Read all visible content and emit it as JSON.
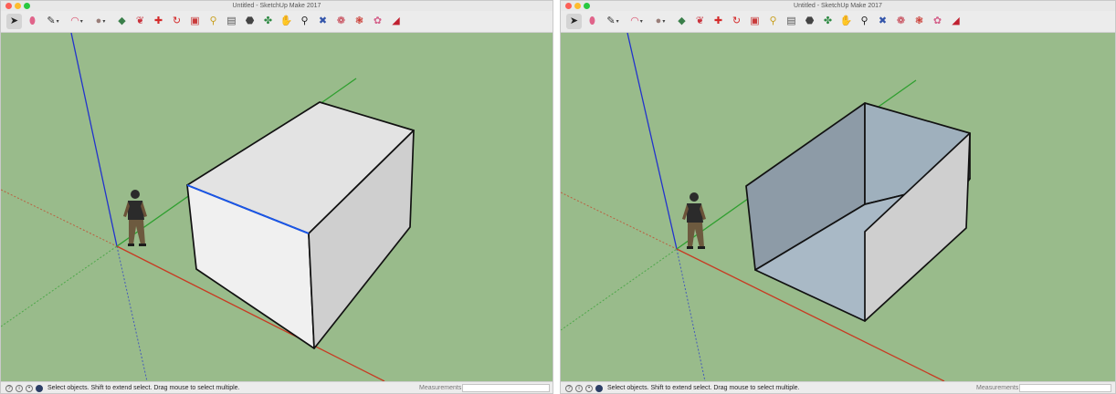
{
  "windows": [
    {
      "title": "Untitled - SketchUp Make 2017",
      "status_text": "Select objects. Shift to extend select. Drag mouse to select multiple.",
      "measurements_label": "Measurements",
      "measurements_value": ""
    },
    {
      "title": "Untitled - SketchUp Make 2017",
      "status_text": "Select objects. Shift to extend select. Drag mouse to select multiple.",
      "measurements_label": "Measurements",
      "measurements_value": ""
    }
  ],
  "toolbar_tools": [
    {
      "name": "select-tool-icon",
      "glyph": "➤",
      "color": "#222222",
      "dropdown": false
    },
    {
      "name": "eraser-tool-icon",
      "glyph": "⬮",
      "color": "#e0648a",
      "dropdown": false
    },
    {
      "name": "line-tool-icon",
      "glyph": "✎",
      "color": "#333333",
      "dropdown": true
    },
    {
      "name": "arc-tool-icon",
      "glyph": "◠",
      "color": "#d94f6b",
      "dropdown": true
    },
    {
      "name": "shapes-tool-icon",
      "glyph": "●",
      "color": "#9a7f7a",
      "dropdown": true
    },
    {
      "name": "push-pull-tool-icon",
      "glyph": "◆",
      "color": "#3a7f4a",
      "dropdown": false
    },
    {
      "name": "offset-tool-icon",
      "glyph": "❦",
      "color": "#c9323c",
      "dropdown": false
    },
    {
      "name": "move-tool-icon",
      "glyph": "✚",
      "color": "#d42a2a",
      "dropdown": false
    },
    {
      "name": "rotate-tool-icon",
      "glyph": "↻",
      "color": "#d42a2a",
      "dropdown": false
    },
    {
      "name": "scale-tool-icon",
      "glyph": "▣",
      "color": "#c93a3a",
      "dropdown": false
    },
    {
      "name": "tape-measure-tool-icon",
      "glyph": "⚲",
      "color": "#c9a020",
      "dropdown": false
    },
    {
      "name": "text-tool-icon",
      "glyph": "▤",
      "color": "#555555",
      "dropdown": false
    },
    {
      "name": "paint-bucket-tool-icon",
      "glyph": "⬣",
      "color": "#444444",
      "dropdown": false
    },
    {
      "name": "orbit-tool-icon",
      "glyph": "✤",
      "color": "#2f8a44",
      "dropdown": false
    },
    {
      "name": "pan-tool-icon",
      "glyph": "✋",
      "color": "#d6a64a",
      "dropdown": false
    },
    {
      "name": "zoom-tool-icon",
      "glyph": "⚲",
      "color": "#222222",
      "dropdown": false
    },
    {
      "name": "zoom-extents-tool-icon",
      "glyph": "✖",
      "color": "#3355aa",
      "dropdown": false
    },
    {
      "name": "3d-warehouse-icon",
      "glyph": "❁",
      "color": "#c03040",
      "dropdown": false
    },
    {
      "name": "extension-warehouse-icon",
      "glyph": "❃",
      "color": "#c9362e",
      "dropdown": false
    },
    {
      "name": "share-model-icon",
      "glyph": "✿",
      "color": "#d4608a",
      "dropdown": false
    },
    {
      "name": "extension-manager-icon",
      "glyph": "◢",
      "color": "#c02030",
      "dropdown": false
    }
  ],
  "colors": {
    "viewport_bg": "#99bb8b",
    "axis_blue": "#2233cc",
    "axis_red": "#c83a22",
    "axis_green": "#2f9f2f",
    "selected_edge": "#1a56e8",
    "box_top": "#e3e3e3",
    "box_front": "#f0f0f0",
    "box_side": "#cfcfcf",
    "hollow_inner": "#8d9ba7",
    "hollow_floor": "#a9b9c6"
  }
}
